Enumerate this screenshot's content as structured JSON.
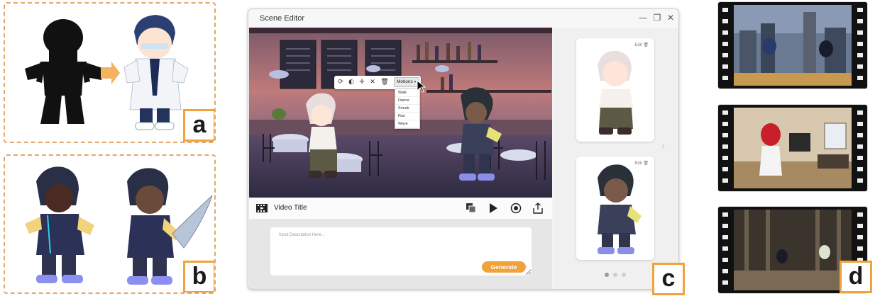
{
  "panel_a": {
    "label": "a"
  },
  "panel_b": {
    "label": "b"
  },
  "panel_c": {
    "label": "c"
  },
  "panel_d": {
    "label": "d"
  },
  "editor": {
    "window_title": "Scene Editor",
    "window_controls": {
      "minimize": "—",
      "maximize": "❐",
      "close": "✕"
    },
    "toolbar": {
      "icons": [
        "rotate-icon",
        "flip-icon",
        "move-icon",
        "pose-icon",
        "delete-icon"
      ],
      "motions_label": "Motions"
    },
    "motions_menu": [
      "Walk",
      "Dance",
      "Sneak",
      "Run",
      "Wave"
    ],
    "video_title": "Video Title",
    "description_placeholder": "Input Description Here...",
    "generate_label": "Generate",
    "characters": [
      {
        "edit_label": "Edit"
      },
      {
        "edit_label": "Edit"
      }
    ],
    "pagination": {
      "pages": 3,
      "current": 1
    }
  },
  "colors": {
    "accent": "#f0a23b",
    "dashed_border": "#e3a86b",
    "editor_bg": "#f3f3f3"
  }
}
